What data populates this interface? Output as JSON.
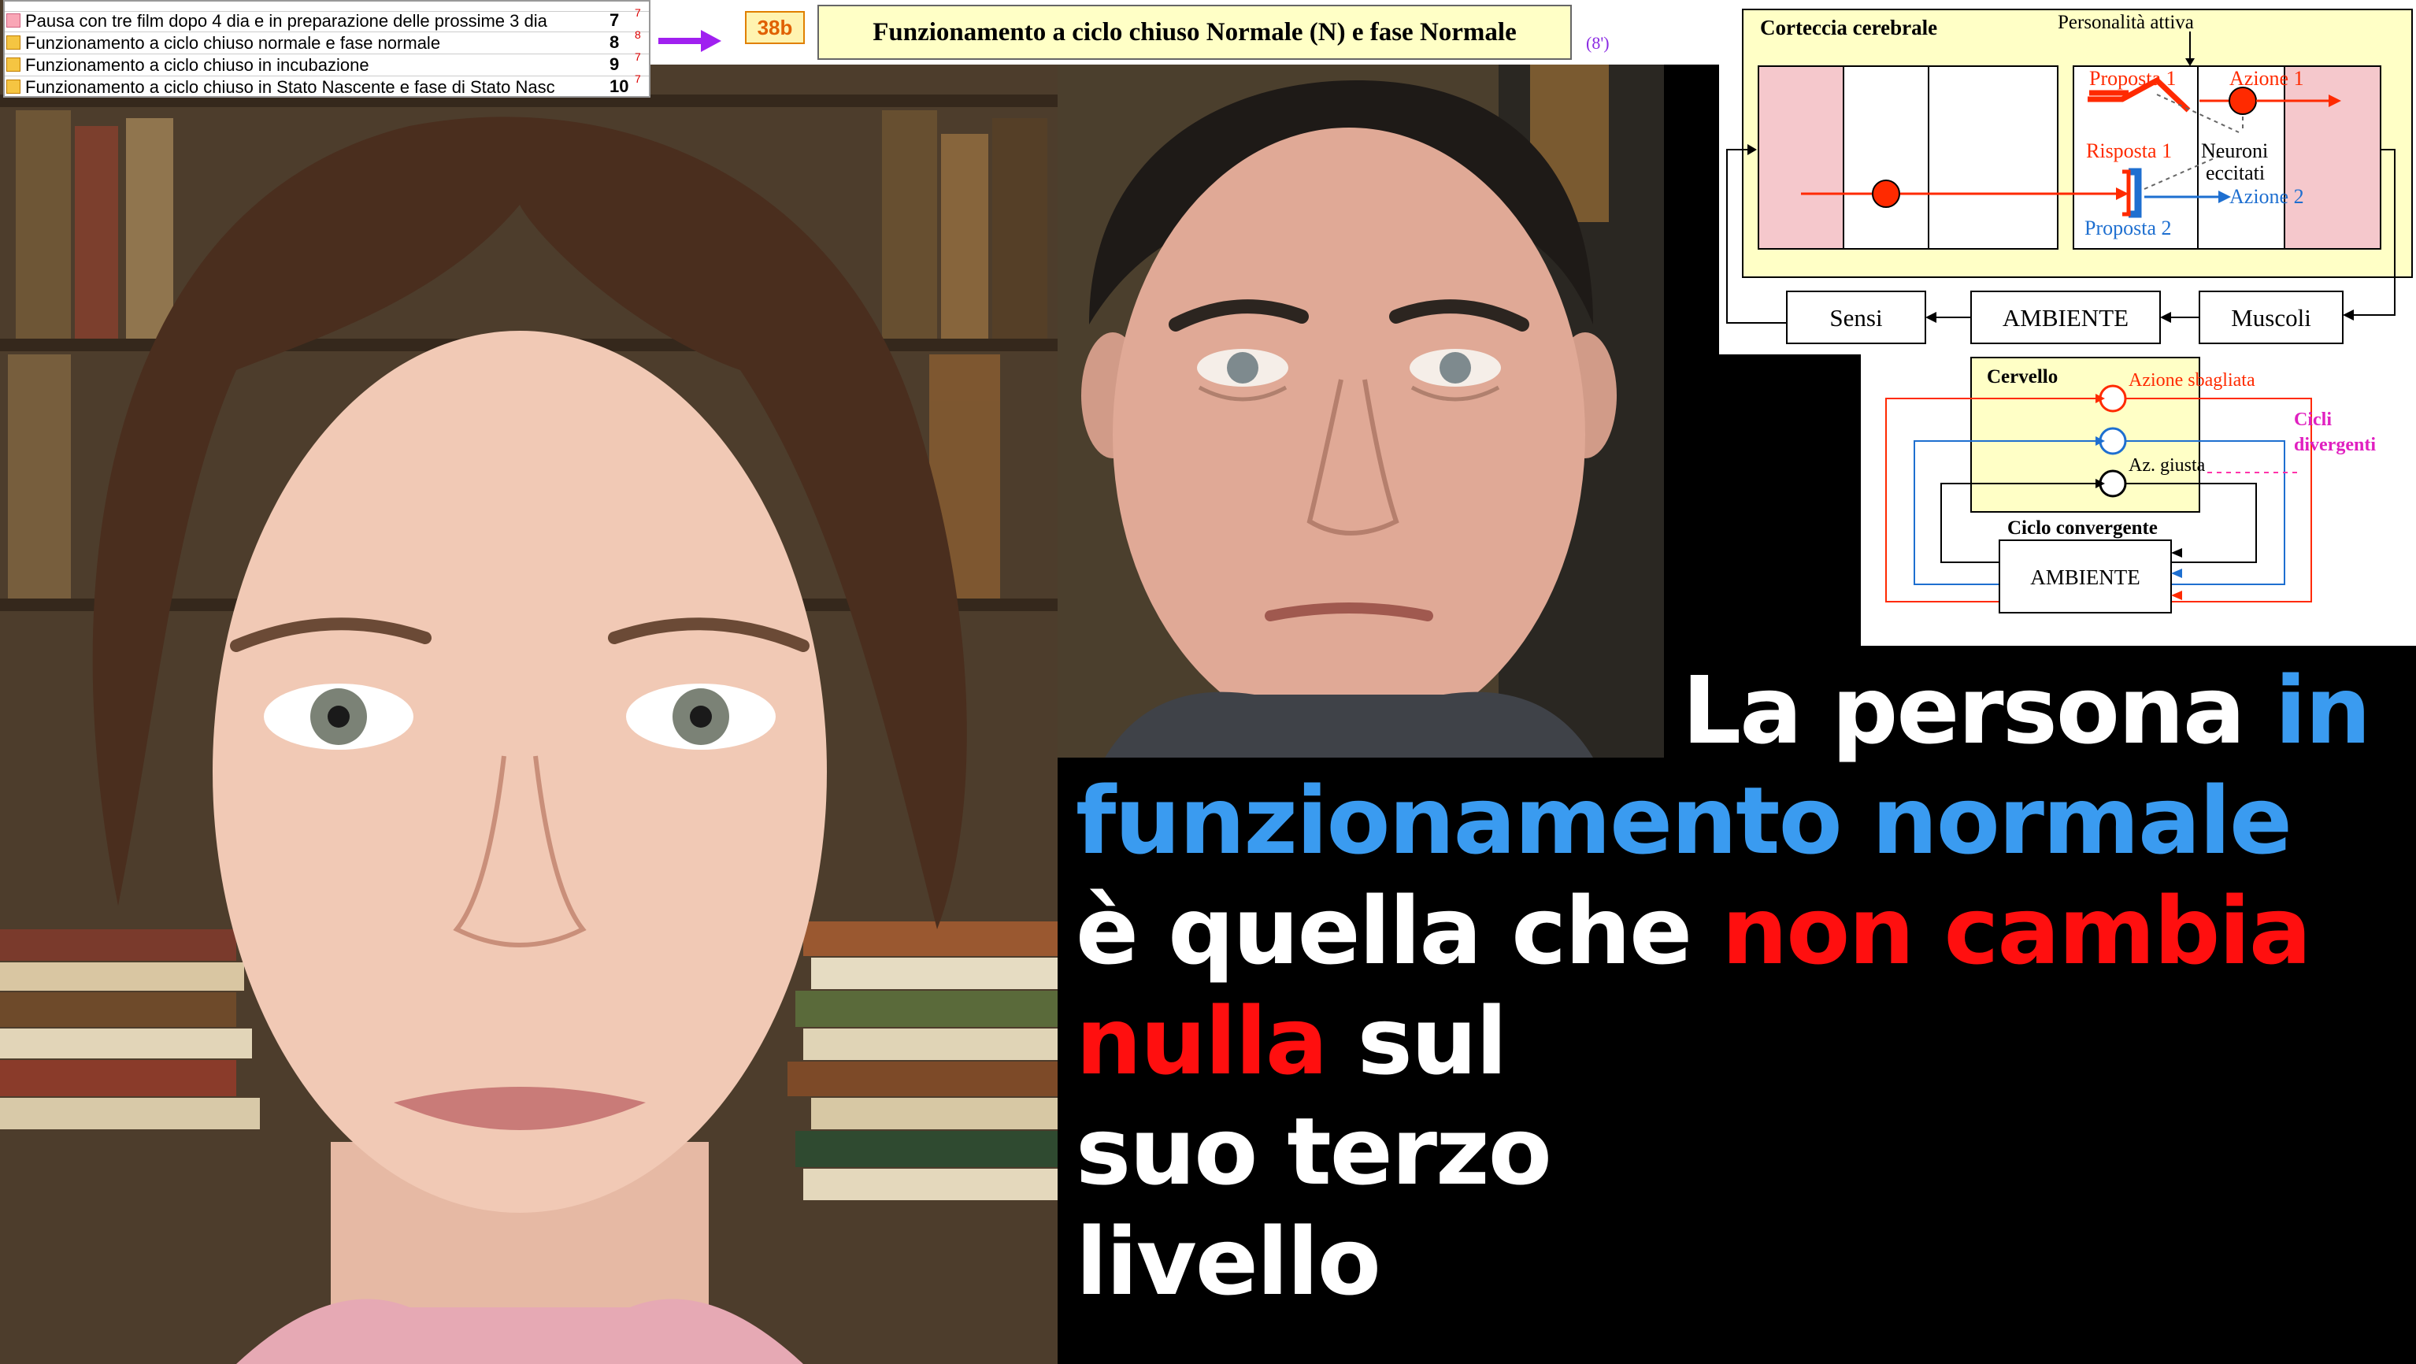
{
  "menu": {
    "rows": [
      {
        "text": "Pausa con tre film dopo 4 dia e in preparazione delle prossime 3 dia",
        "num": "7",
        "sup": "7",
        "marker": "pink"
      },
      {
        "text": "Funzionamento a ciclo chiuso normale e fase normale",
        "num": "8",
        "sup": "8",
        "marker": "yellow"
      },
      {
        "text": "Funzionamento a ciclo chiuso in incubazione",
        "num": "9",
        "sup": "7",
        "marker": "yellow"
      },
      {
        "text": "Funzionamento a ciclo chiuso in Stato Nascente e fase di Stato Nasc",
        "num": "10",
        "sup": "7",
        "marker": "yellow"
      }
    ]
  },
  "header": {
    "badge": "38b",
    "title": "Funzionamento a ciclo chiuso Normale (N) e fase Normale",
    "duration": "(8')",
    "arrow_color": "#a020f0"
  },
  "diagram_top": {
    "cortex_label": "Corteccia cerebrale",
    "personality_label": "Personalità attiva",
    "proposal1": "Proposta 1",
    "action1": "Azione 1",
    "response1": "Risposta 1",
    "neurons_line1": "Neuroni",
    "neurons_line2": "eccitati",
    "action2": "Azione 2",
    "proposal2": "Proposta 2",
    "senses": "Sensi",
    "environment": "AMBIENTE",
    "muscles": "Muscoli"
  },
  "diagram_bottom": {
    "brain": "Cervello",
    "wrong_action": "Azione sbagliata",
    "right_action": "Az. giusta",
    "divergent_line1": "Cicli",
    "divergent_line2": "divergenti",
    "convergent": "Ciclo convergente",
    "environment": "AMBIENTE"
  },
  "headline": {
    "l1_a": "La persona ",
    "l1_b": "in",
    "l2": "funzionamento normale",
    "l3_a": "è quella che ",
    "l3_b": "non cambia",
    "l4_a": "nulla",
    "l4_b": " sul",
    "l5": "suo terzo",
    "l6": "livello"
  },
  "colors": {
    "white": "#ffffff",
    "blue": "#3a9bf0",
    "red": "#ff0f0f",
    "diagram_red": "#ff2a00",
    "diagram_blue": "#1e6fd0",
    "pink": "#f5c8cc",
    "yellow": "#ffffc6"
  }
}
